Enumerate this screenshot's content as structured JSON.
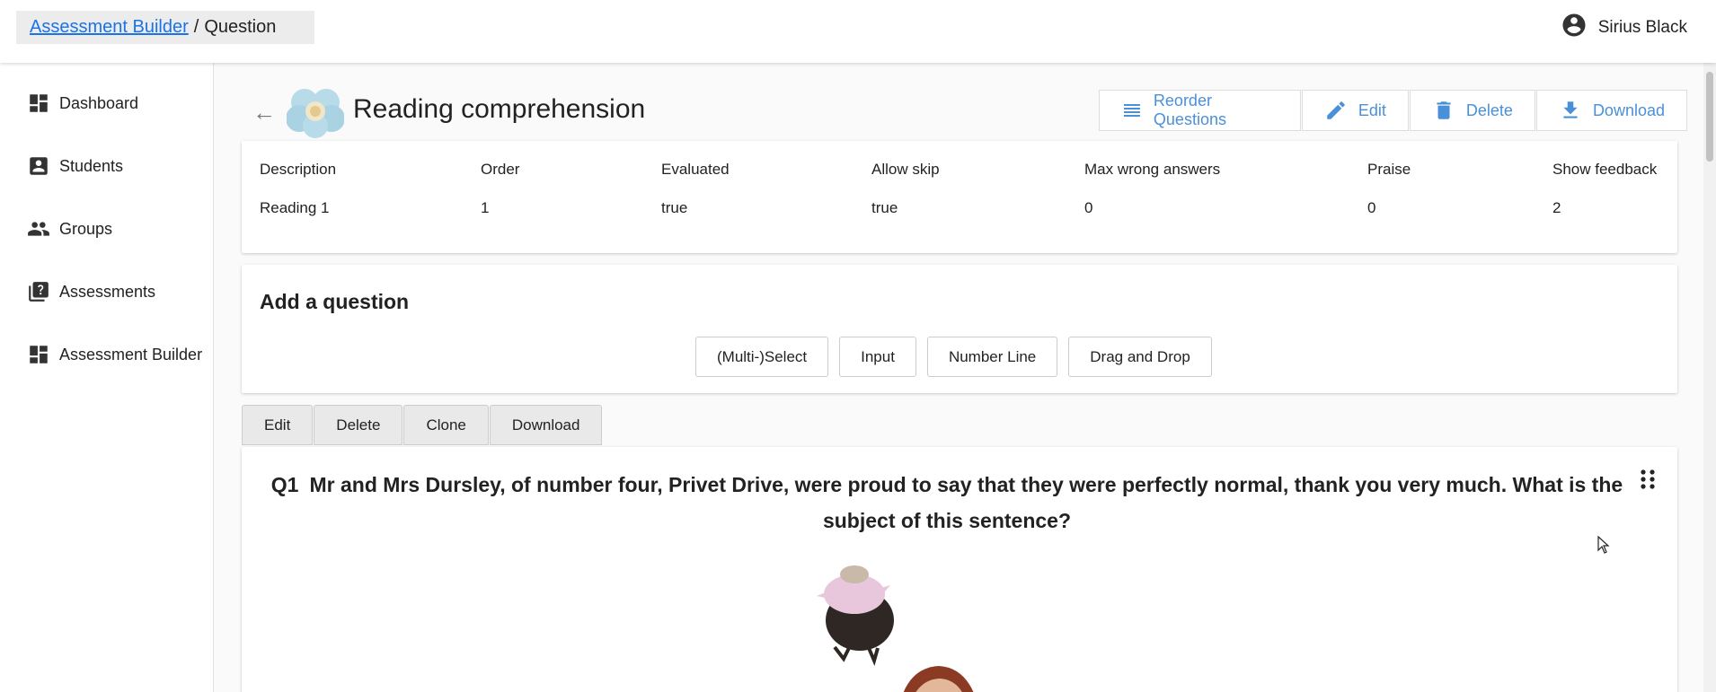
{
  "topbar": {
    "breadcrumb_link": "Assessment Builder",
    "breadcrumb_sep": "/",
    "breadcrumb_current": "Question",
    "user_name": "Sirius Black"
  },
  "sidebar": {
    "items": [
      {
        "label": "Dashboard",
        "icon": "dashboard-icon"
      },
      {
        "label": "Students",
        "icon": "student-card-icon"
      },
      {
        "label": "Groups",
        "icon": "groups-icon"
      },
      {
        "label": "Assessments",
        "icon": "question-library-icon"
      },
      {
        "label": "Assessment Builder",
        "icon": "dashboard-icon"
      }
    ]
  },
  "header": {
    "back": "←",
    "title": "Reading comprehension",
    "actions": {
      "reorder": "Reorder Questions",
      "edit": "Edit",
      "delete": "Delete",
      "download": "Download"
    }
  },
  "info": {
    "headers": [
      "Description",
      "Order",
      "Evaluated",
      "Allow skip",
      "Max wrong answers",
      "Praise",
      "Show feedback"
    ],
    "values": [
      "Reading 1",
      "1",
      "true",
      "true",
      "0",
      "0",
      "2"
    ]
  },
  "add_question": {
    "title": "Add a question",
    "types": [
      "(Multi-)Select",
      "Input",
      "Number Line",
      "Drag and Drop"
    ]
  },
  "question_toolbar": {
    "edit": "Edit",
    "delete": "Delete",
    "clone": "Clone",
    "download": "Download"
  },
  "question": {
    "number": "Q1",
    "text": "Mr and Mrs Dursley, of number four, Privet Drive, were proud to say that they were perfectly normal, thank you very much. What is the subject of this sentence?"
  },
  "colors": {
    "accent": "#4a90d9",
    "link": "#1a73e8"
  }
}
